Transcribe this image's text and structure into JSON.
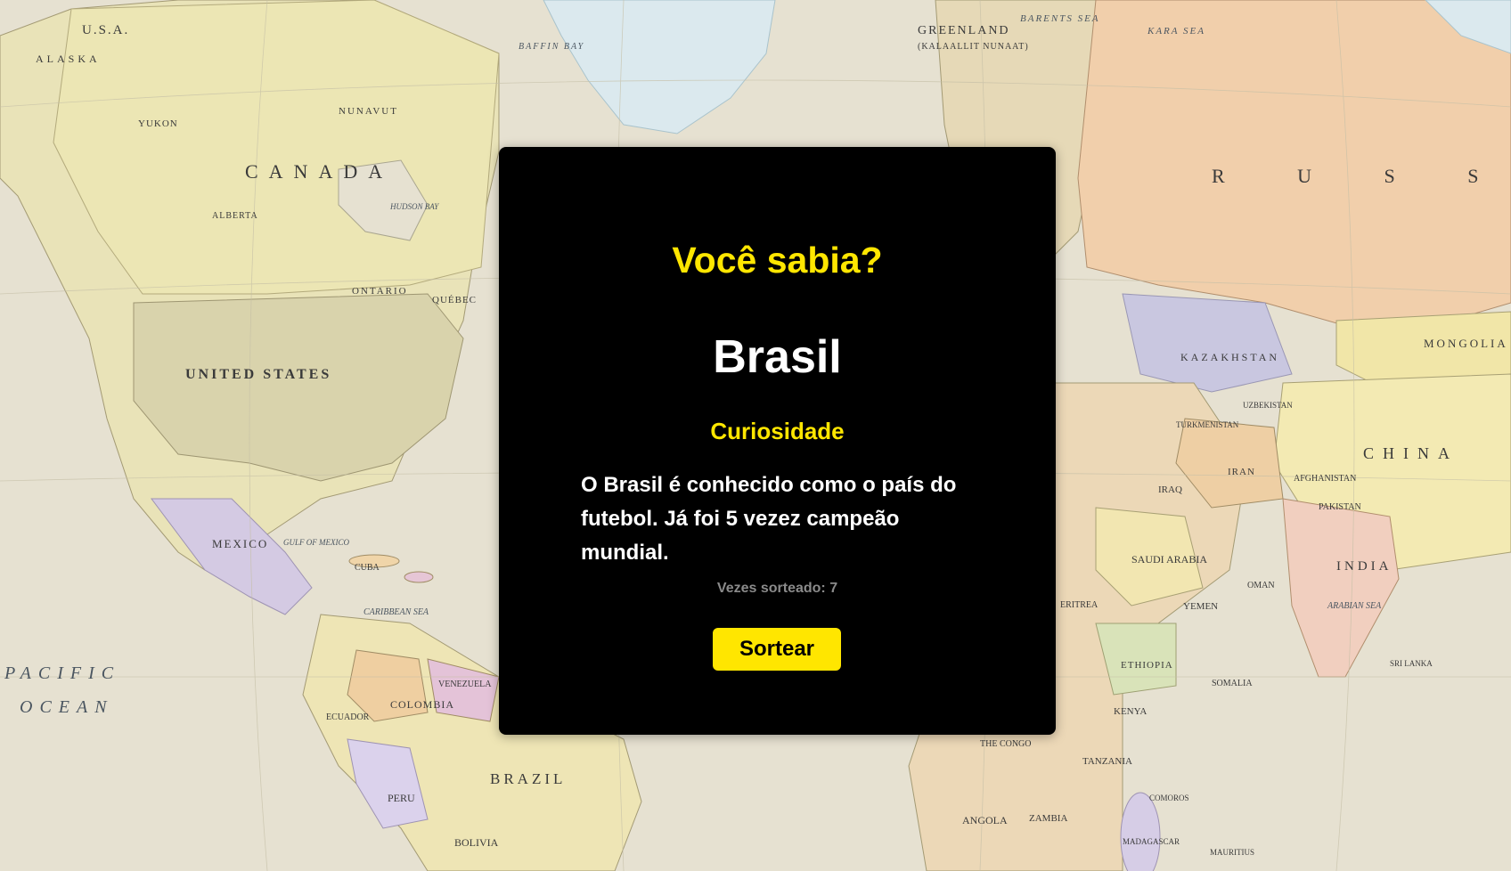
{
  "map": {
    "labels": {
      "greenland": "GREENLAND",
      "greenland_sub": "(KALAALLIT NUNAAT)",
      "usa_top": "U.S.A.",
      "alaska": "ALASKA",
      "canada": "CANADA",
      "united_states": "UNITED STATES",
      "mexico": "MEXICO",
      "colombia": "COLOMBIA",
      "brazil": "BRAZIL",
      "peru": "PERU",
      "bolivia": "BOLIVIA",
      "venezuela": "VENEZUELA",
      "ecuador": "ECUADOR",
      "cuba": "CUBA",
      "pacific": "PACIFIC",
      "ocean": "OCEAN",
      "baffin_bay": "BAFFIN BAY",
      "barents_sea": "BARENTS SEA",
      "kara_sea": "KARA SEA",
      "russia": "R U S S I",
      "kazakhstan": "KAZAKHSTAN",
      "mongolia": "MONGOLIA",
      "china": "CHINA",
      "india": "INDIA",
      "iran": "IRAN",
      "iraq": "IRAQ",
      "afghanistan": "AFGHANISTAN",
      "pakistan": "PAKISTAN",
      "saudi_arabia": "SAUDI ARABIA",
      "yemen": "YEMEN",
      "oman": "OMAN",
      "ethiopia": "ETHIOPIA",
      "somalia": "SOMALIA",
      "kenya": "KENYA",
      "tanzania": "TANZANIA",
      "angola": "ANGOLA",
      "zambia": "ZAMBIA",
      "madagascar": "MADAGASCAR",
      "arabian_sea": "ARABIAN SEA",
      "caribbean_sea": "CARIBBEAN SEA",
      "gulf_of_mexico": "GULF OF MEXICO",
      "ontario": "ONTARIO",
      "quebec": "QUÉBEC",
      "alberta": "ALBERTA",
      "yukon": "YUKON",
      "nunavut": "NUNAVUT",
      "hudson_bay": "HUDSON BAY",
      "sri_lanka": "SRI LANKA",
      "turkmenistan": "TURKMENISTAN",
      "uzbekistan": "UZBEKISTAN",
      "eritrea": "ERITREA",
      "comoros": "COMOROS",
      "mauritius": "MAURITIUS",
      "dr_congo": "THE CONGO"
    }
  },
  "card": {
    "title": "Você sabia?",
    "country": "Brasil",
    "section_label": "Curiosidade",
    "fact": "O Brasil é conhecido como o país do futebol. Já foi 5 vezez campeão mundial.",
    "draw_count_label": "Vezes sorteado:",
    "draw_count_value": "7",
    "button_label": "Sortear"
  },
  "colors": {
    "accent_yellow": "#ffe600",
    "card_bg": "#000000",
    "muted_text": "#8a8a8a"
  }
}
